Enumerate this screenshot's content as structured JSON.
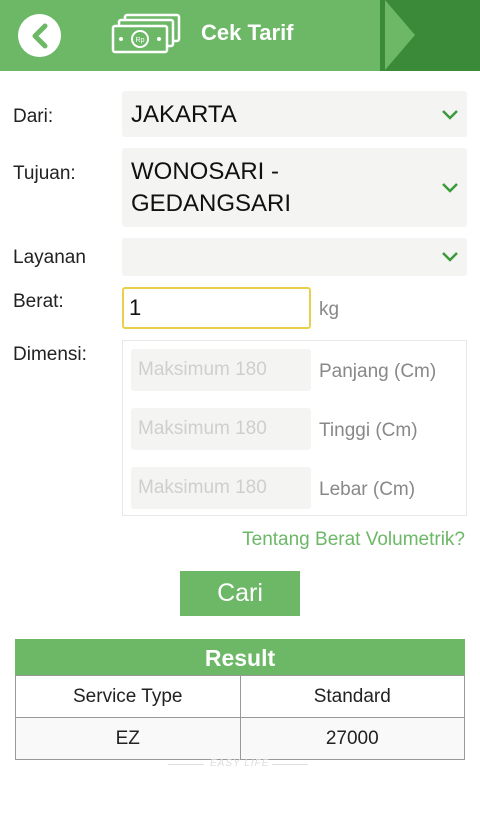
{
  "header": {
    "title": "Cek Tarif",
    "back_icon": "chevron-left-icon",
    "logo_icon": "money-icon",
    "logo_text": "Rp",
    "colors": {
      "primary": "#6cb866",
      "dark": "#3a8a3a"
    }
  },
  "form": {
    "from_label": "Dari:",
    "from_value": "JAKARTA",
    "to_label": "Tujuan:",
    "to_value_line1": "WONOSARI -",
    "to_value_line2": "GEDANGSARI",
    "service_label": "Layanan",
    "service_value": "",
    "weight_label": "Berat:",
    "weight_value": "1",
    "weight_unit": "kg",
    "dimension_label": "Dimensi:",
    "dimensions": [
      {
        "placeholder": "Maksimum 180",
        "label": "Panjang (Cm)"
      },
      {
        "placeholder": "Maksimum 180",
        "label": "Tinggi (Cm)"
      },
      {
        "placeholder": "Maksimum 180",
        "label": "Lebar (Cm)"
      }
    ],
    "volumetric_link": "Tentang Berat Volumetrik?",
    "search_button": "Cari"
  },
  "result": {
    "title": "Result",
    "headers": [
      "Service Type",
      "Standard"
    ],
    "rows": [
      [
        "EZ",
        "27000"
      ]
    ]
  },
  "footer": {
    "watermark": "EASY LIFE"
  }
}
